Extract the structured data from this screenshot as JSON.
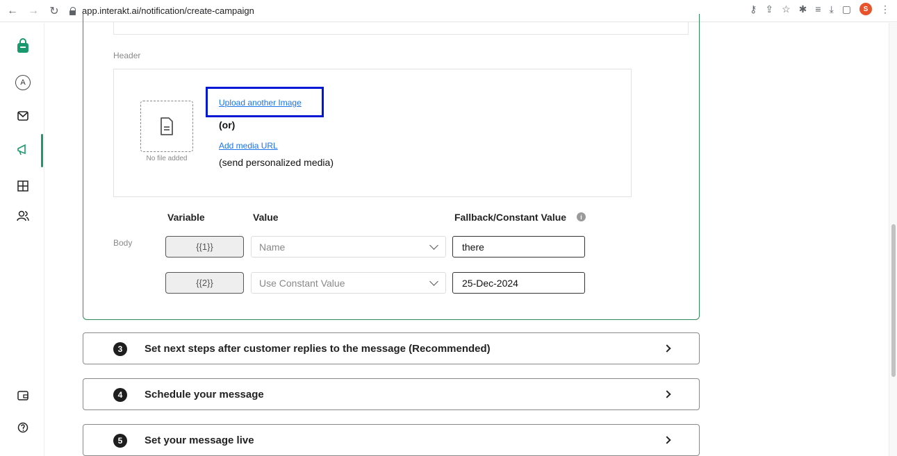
{
  "browser": {
    "url": "app.interakt.ai/notification/create-campaign",
    "profile_initial": "S"
  },
  "header_section": {
    "label": "Header",
    "no_file_text": "No file added",
    "upload_link": "Upload another Image",
    "or_text": "(or)",
    "media_url_link": "Add media URL",
    "personalized_text": "(send personalized media)"
  },
  "body_section": {
    "label": "Body",
    "columns": {
      "variable": "Variable",
      "value": "Value",
      "fallback": "Fallback/Constant Value"
    },
    "rows": [
      {
        "variable": "{{1}}",
        "value": "Name",
        "fallback": "there"
      },
      {
        "variable": "{{2}}",
        "value": "Use Constant Value",
        "fallback": "25-Dec-2024"
      }
    ]
  },
  "steps": [
    {
      "number": "3",
      "title": "Set next steps after customer replies to the message (Recommended)"
    },
    {
      "number": "4",
      "title": "Schedule your message"
    },
    {
      "number": "5",
      "title": "Set your message live"
    }
  ],
  "sidebar": {
    "items": [
      "bag-icon",
      "account-icon",
      "mail-icon",
      "campaign-icon",
      "grid-icon",
      "users-icon"
    ],
    "bottom_items": [
      "wallet-icon",
      "help-icon"
    ],
    "account_initial": "A"
  },
  "colors": {
    "accent": "#1a9a6c",
    "card_border": "#2e8b57",
    "highlight": "#0018d6",
    "link": "#1a73e8"
  }
}
